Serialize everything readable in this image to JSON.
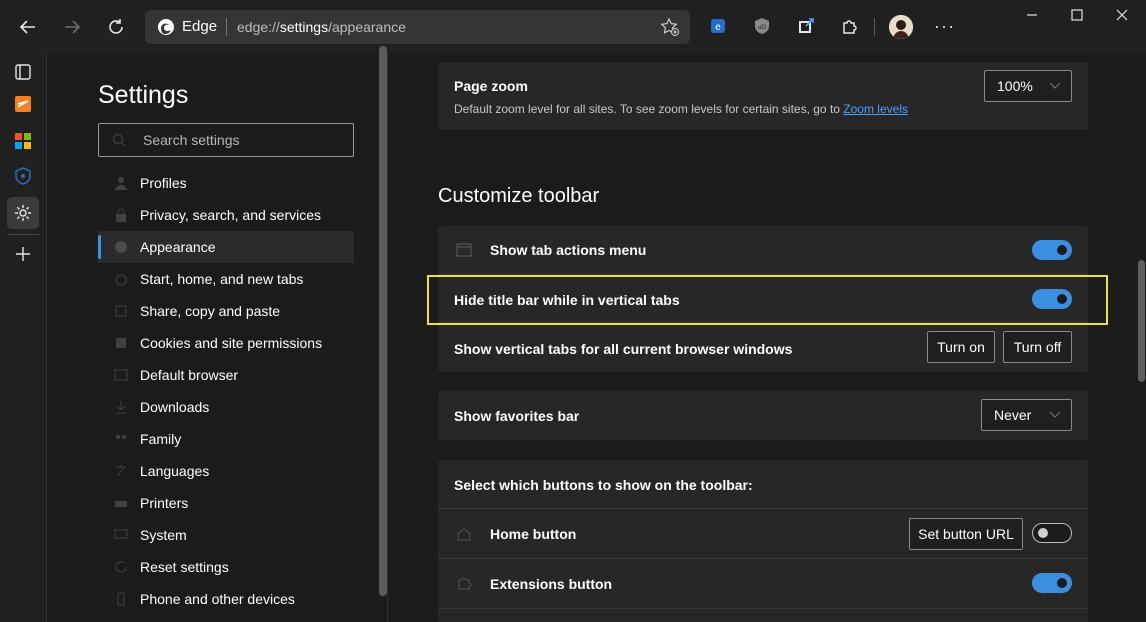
{
  "browser": {
    "brand": "Edge",
    "url_prefix": "edge://",
    "url_highlight": "settings",
    "url_suffix": "/appearance"
  },
  "settings": {
    "title": "Settings",
    "search_placeholder": "Search settings",
    "nav": [
      {
        "label": "Profiles",
        "icon": "person-icon"
      },
      {
        "label": "Privacy, search, and services",
        "icon": "lock-icon"
      },
      {
        "label": "Appearance",
        "icon": "palette-icon",
        "active": true
      },
      {
        "label": "Start, home, and new tabs",
        "icon": "power-icon"
      },
      {
        "label": "Share, copy and paste",
        "icon": "share-icon"
      },
      {
        "label": "Cookies and site permissions",
        "icon": "cookie-icon"
      },
      {
        "label": "Default browser",
        "icon": "browser-icon"
      },
      {
        "label": "Downloads",
        "icon": "download-icon"
      },
      {
        "label": "Family",
        "icon": "family-icon"
      },
      {
        "label": "Languages",
        "icon": "language-icon"
      },
      {
        "label": "Printers",
        "icon": "printer-icon"
      },
      {
        "label": "System",
        "icon": "system-icon"
      },
      {
        "label": "Reset settings",
        "icon": "reset-icon"
      },
      {
        "label": "Phone and other devices",
        "icon": "phone-icon"
      }
    ]
  },
  "page_zoom": {
    "title": "Page zoom",
    "desc": "Default zoom level for all sites. To see zoom levels for certain sites, go to ",
    "link": "Zoom levels",
    "value": "100%"
  },
  "customize_toolbar": {
    "heading": "Customize toolbar",
    "show_tab_actions": {
      "label": "Show tab actions menu",
      "on": true
    },
    "hide_title_bar": {
      "label": "Hide title bar while in vertical tabs",
      "on": true
    },
    "vertical_tabs_all": {
      "label": "Show vertical tabs for all current browser windows",
      "turn_on": "Turn on",
      "turn_off": "Turn off"
    },
    "favorites_bar": {
      "label": "Show favorites bar",
      "value": "Never"
    },
    "buttons_header": "Select which buttons to show on the toolbar:",
    "home_button": {
      "label": "Home button",
      "set_url": "Set button URL",
      "on": false
    },
    "extensions_button": {
      "label": "Extensions button",
      "on": true
    }
  },
  "colors": {
    "accent": "#3b8fe0",
    "highlight_box": "#f0e040",
    "link": "#4ba0ff"
  }
}
